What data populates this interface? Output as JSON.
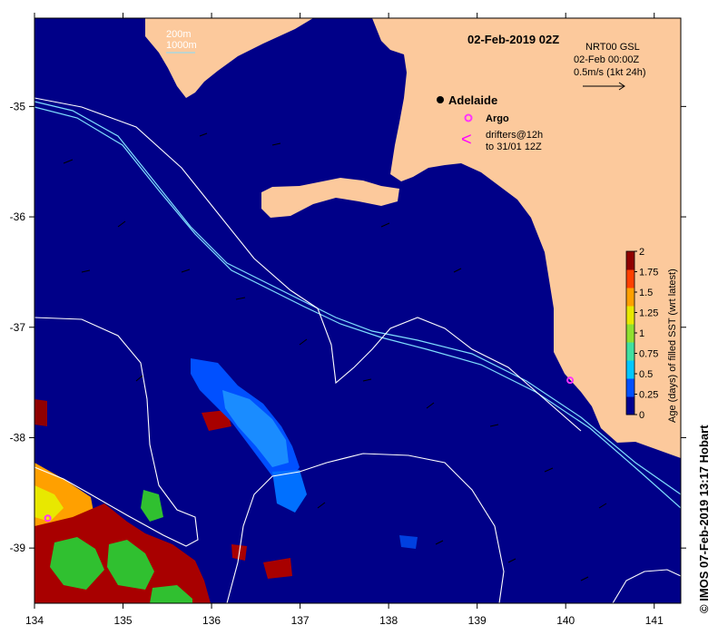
{
  "title": "02-Feb-2019 02Z",
  "credit": "© IMOS 07-Feb-2019 13:17 Hobart",
  "axes": {
    "x_ticks": [
      "134",
      "135",
      "136",
      "137",
      "138",
      "139",
      "140",
      "141"
    ],
    "y_ticks": [
      "-35",
      "-36",
      "-37",
      "-38",
      "-39"
    ],
    "lon_range": [
      134,
      141.3
    ],
    "lat_range": [
      -39.5,
      -34.2
    ]
  },
  "depth_legend": {
    "contour_1": "200m",
    "contour_2": "1000m"
  },
  "current_legend": {
    "line1": "NRT00 GSL",
    "line2": "02-Feb 00:00Z",
    "line3": "0.5m/s (1kt 24h)"
  },
  "places": [
    {
      "name": "Adelaide",
      "lon": 138.6,
      "lat": -34.93
    }
  ],
  "argo": {
    "label": "Argo",
    "floats": [
      {
        "lon": 134.15,
        "lat": -38.73
      },
      {
        "lon": 140.05,
        "lat": -37.48
      }
    ]
  },
  "drifters": {
    "line1": "drifters@12h",
    "line2": "to 31/01 12Z",
    "symbol": "<"
  },
  "colorbar": {
    "label": "Age (days) of filled SST (wrt latest)",
    "ticks": [
      "0",
      "0.25",
      "0.5",
      "0.75",
      "1",
      "1.25",
      "1.5",
      "1.75",
      "2"
    ],
    "range": [
      0,
      2
    ],
    "colors": [
      "#000090",
      "#0050ff",
      "#00c8ff",
      "#40e0a0",
      "#90e030",
      "#e8e800",
      "#ffa000",
      "#ff4000",
      "#900000"
    ]
  },
  "colors": {
    "ocean": "#000088",
    "land": "#fcc99c",
    "isobath_200": "#80e0ff",
    "isobath_1000": "#ffffff",
    "argo": "#ff33ff",
    "drifter": "#ff00ff"
  }
}
